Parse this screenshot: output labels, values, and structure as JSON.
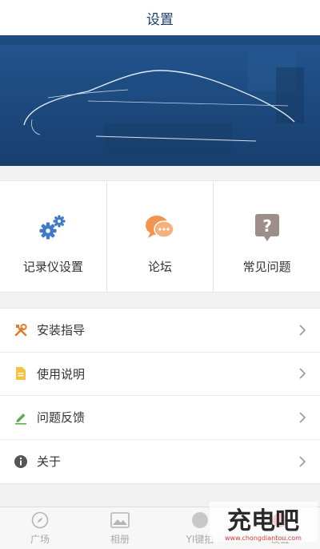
{
  "header": {
    "title": "设置"
  },
  "grid": [
    {
      "label": "记录仪设置",
      "icon": "gears-icon"
    },
    {
      "label": "论坛",
      "icon": "chat-bubbles-icon"
    },
    {
      "label": "常见问题",
      "icon": "question-icon"
    }
  ],
  "list": [
    {
      "label": "安装指导",
      "icon": "tools-icon"
    },
    {
      "label": "使用说明",
      "icon": "document-icon"
    },
    {
      "label": "问题反馈",
      "icon": "pencil-icon"
    },
    {
      "label": "关于",
      "icon": "info-icon"
    }
  ],
  "tabs": [
    {
      "label": "广场",
      "icon": "compass-icon"
    },
    {
      "label": "相册",
      "icon": "image-icon"
    },
    {
      "label": "YI键拍",
      "icon": "circle-icon"
    },
    {
      "label": "设置",
      "icon": "settings-icon"
    }
  ],
  "watermark": {
    "text": "充电吧",
    "url": "www.chongdiantou.com"
  },
  "colors": {
    "primary": "#1e4f8a",
    "gear": "#3f7bc4",
    "chat": "#f0954f",
    "question": "#9e8e8b",
    "tool": "#e07b2c",
    "doc": "#f5c343",
    "pencil": "#5bb04a",
    "info": "#555555"
  }
}
